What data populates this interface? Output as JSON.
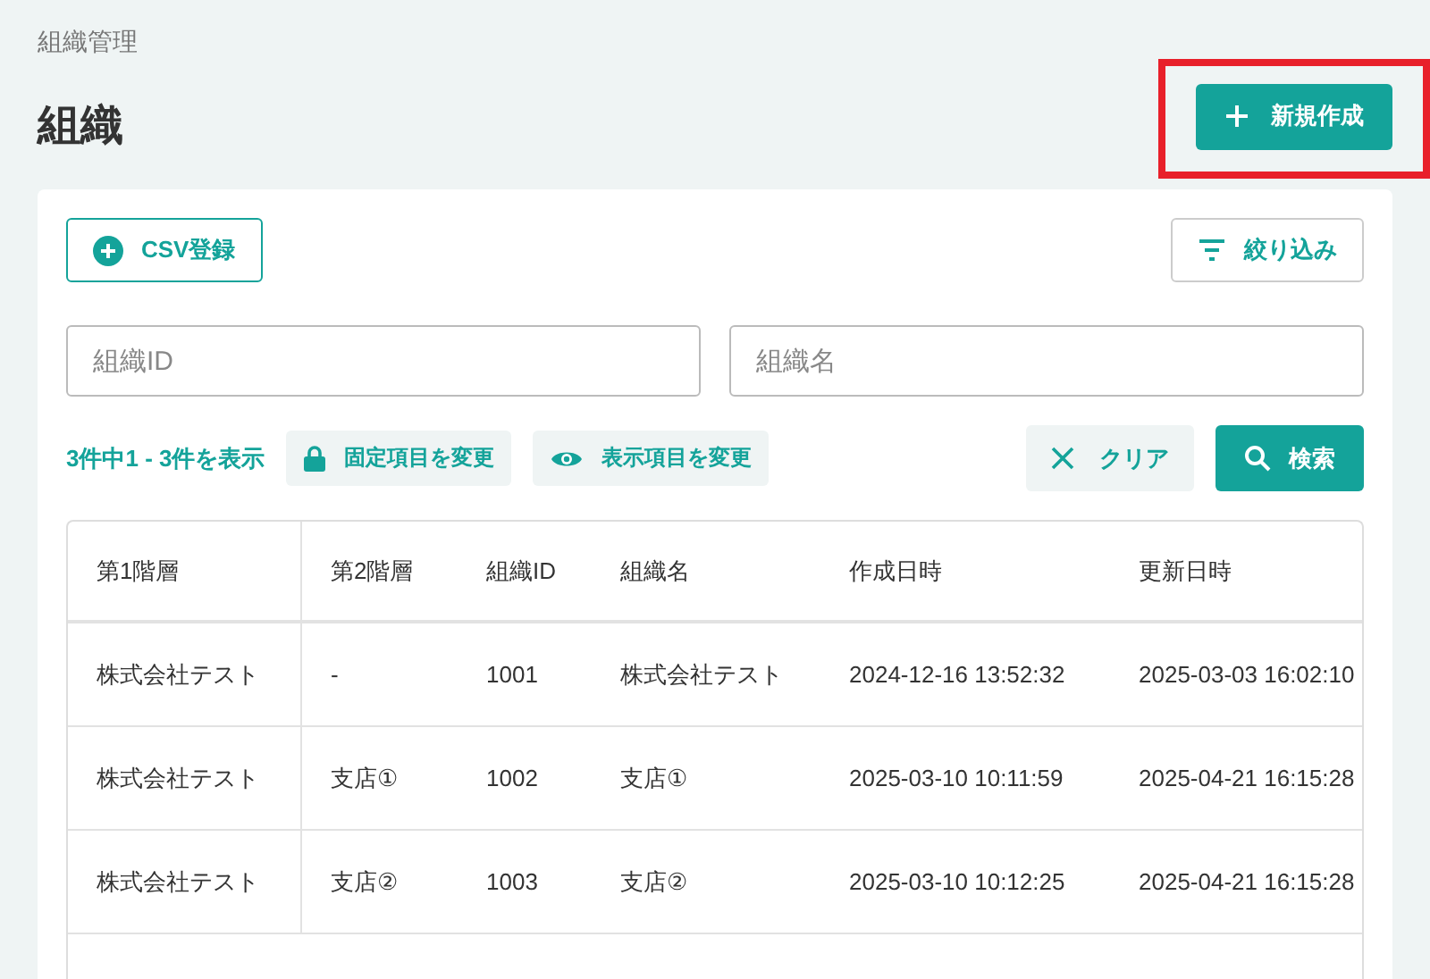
{
  "breadcrumb": "組織管理",
  "title": "組織",
  "new_button": {
    "label": "新規作成",
    "highlighted": true
  },
  "csv_button": {
    "label": "CSV登録"
  },
  "filter_button": {
    "label": "絞り込み"
  },
  "fields": [
    {
      "placeholder": "組織ID"
    },
    {
      "placeholder": "組織名"
    }
  ],
  "result_count": "3件中1 - 3件を表示",
  "fixed_button": {
    "label": "固定項目を変更"
  },
  "display_button": {
    "label": "表示項目を変更"
  },
  "clear_button": {
    "label": "クリア"
  },
  "search_button": {
    "label": "検索"
  },
  "table": {
    "columns": [
      "第1階層",
      "第2階層",
      "組織ID",
      "組織名",
      "作成日時",
      "更新日時"
    ],
    "rows": [
      [
        "株式会社テスト",
        "-",
        "1001",
        "株式会社テスト",
        "2024-12-16 13:52:32",
        "2025-03-03 16:02:10"
      ],
      [
        "株式会社テスト",
        "支店①",
        "1002",
        "支店①",
        "2025-03-10 10:11:59",
        "2025-04-21 16:15:28"
      ],
      [
        "株式会社テスト",
        "支店②",
        "1003",
        "支店②",
        "2025-03-10 10:12:25",
        "2025-04-21 16:15:28"
      ]
    ]
  }
}
